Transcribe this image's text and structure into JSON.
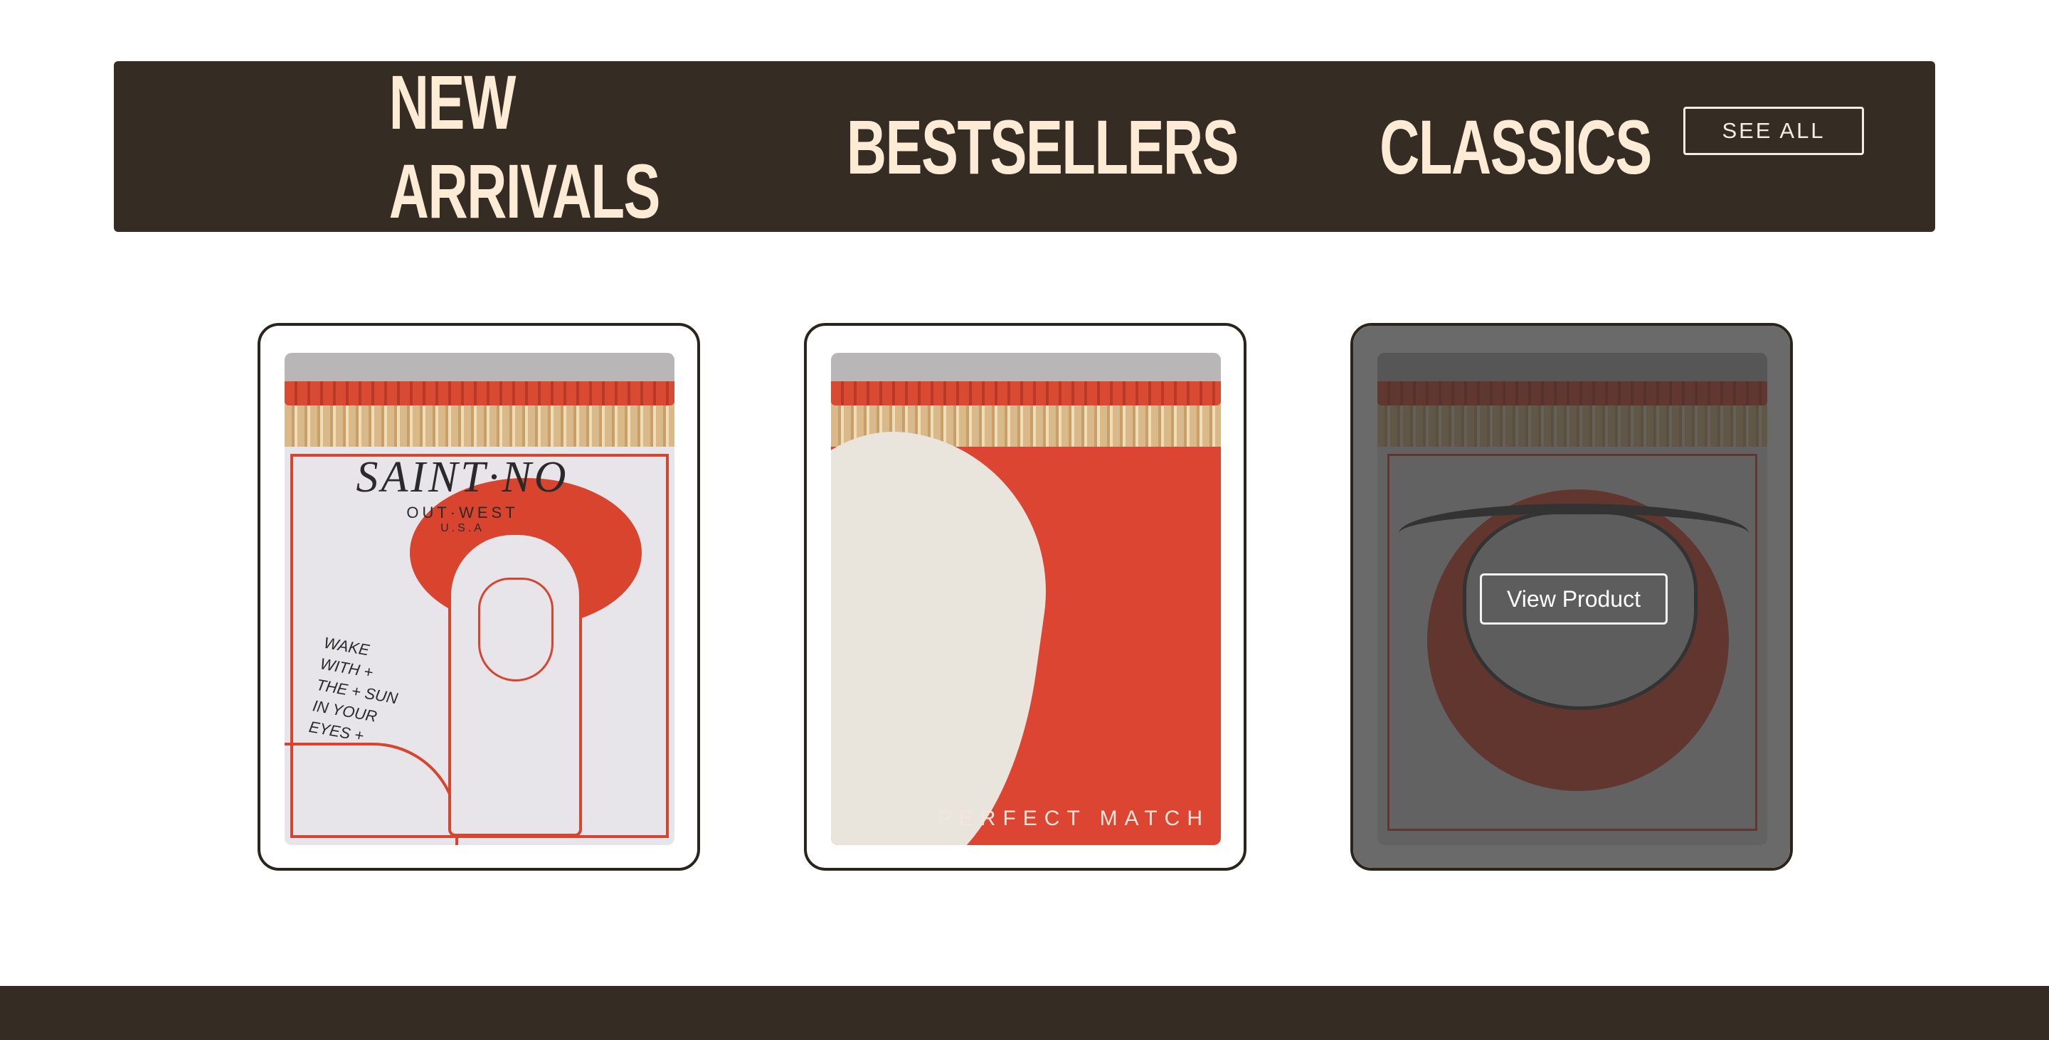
{
  "nav": {
    "tabs": [
      {
        "label": "NEW ARRIVALS"
      },
      {
        "label": "BESTSELLERS"
      },
      {
        "label": "CLASSICS"
      }
    ],
    "see_all_label": "SEE ALL"
  },
  "products": [
    {
      "artwork": {
        "brand": "SAINT·NO",
        "subtitle": "OUT·WEST",
        "country": "U.S.A",
        "slogan": "WAKE WITH + THE + SUN IN YOUR EYES +"
      }
    },
    {
      "artwork": {
        "caption": "PERFECT MATCH"
      }
    },
    {
      "hover_button_label": "View Product"
    }
  ],
  "colors": {
    "nav_background": "#352c23",
    "nav_text": "#fdebd6",
    "card_border": "#2b241d",
    "match_red": "#d9442e",
    "footer_background": "#352c23"
  }
}
